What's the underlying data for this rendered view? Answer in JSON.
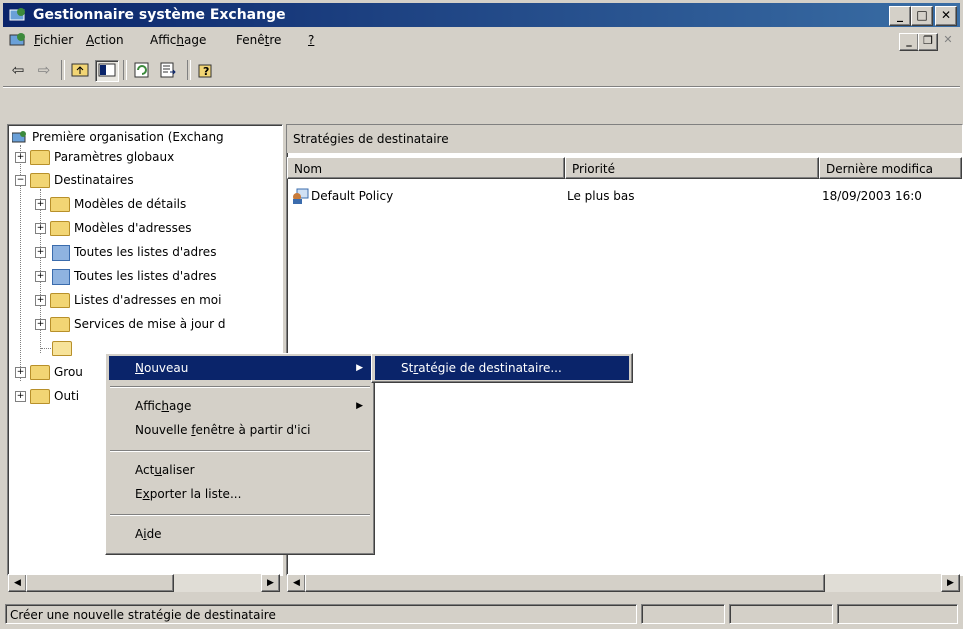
{
  "window": {
    "title": "Gestionnaire système Exchange",
    "caption_buttons": [
      "_",
      "□",
      "✕"
    ]
  },
  "menu": {
    "items": [
      {
        "label": "Fichier",
        "underline": "F",
        "rest": "ichier"
      },
      {
        "label": "Action",
        "underline": "A",
        "rest": "ction"
      },
      {
        "label": "Affichage",
        "pre": "Affic",
        "underline": "h",
        "rest": "age"
      },
      {
        "label": "Fenêtre",
        "pre": "Fenê",
        "underline": "t",
        "rest": "re"
      },
      {
        "label": "?",
        "underline": "?",
        "rest": ""
      }
    ]
  },
  "toolbar": {
    "icons": [
      "back-arrow-icon",
      "forward-arrow-icon",
      "up-folder-icon",
      "show-hide-tree-icon",
      "refresh-icon",
      "export-list-icon",
      "help-icon"
    ]
  },
  "tree": {
    "root": "Première organisation (Exchang",
    "items": [
      {
        "label": "Paramètres globaux",
        "level": 1,
        "icon": "folder",
        "expander": "+"
      },
      {
        "label": "Destinataires",
        "level": 1,
        "icon": "folder",
        "expander": "−"
      },
      {
        "label": "Modèles de détails",
        "level": 2,
        "icon": "folder",
        "expander": "+"
      },
      {
        "label": "Modèles d'adresses",
        "level": 2,
        "icon": "folder",
        "expander": "+"
      },
      {
        "label": "Toutes les listes d'adres",
        "level": 2,
        "icon": "book",
        "expander": "+"
      },
      {
        "label": "Toutes les listes d'adres",
        "level": 2,
        "icon": "book",
        "expander": "+"
      },
      {
        "label": "Listes d'adresses en moi",
        "level": 2,
        "icon": "folder",
        "expander": "+"
      },
      {
        "label": "Services de mise à jour d",
        "level": 2,
        "icon": "folder",
        "expander": "+"
      },
      {
        "label": "",
        "level": 2,
        "icon": "folder-open",
        "expander": ""
      },
      {
        "label": "Grou",
        "level": 1,
        "icon": "folder",
        "expander": "+"
      },
      {
        "label": "Outi",
        "level": 1,
        "icon": "folder",
        "expander": "+"
      }
    ]
  },
  "right": {
    "header": "Stratégies de destinataire",
    "columns": [
      "Nom",
      "Priorité",
      "Dernière modifica"
    ],
    "rows": [
      {
        "name": "Default Policy",
        "priority": "Le plus bas",
        "modified": "18/09/2003 16:0"
      }
    ]
  },
  "context_menu": {
    "items": [
      {
        "pre": "",
        "underline": "N",
        "rest": "ouveau",
        "submenu": true
      },
      {
        "pre": "Affic",
        "underline": "h",
        "rest": "age",
        "submenu": true
      },
      {
        "pre": "Nouvelle ",
        "underline": "f",
        "rest": "enêtre à partir d'ici",
        "submenu": false
      },
      {
        "pre": "Act",
        "underline": "u",
        "rest": "aliser",
        "submenu": false
      },
      {
        "pre": "E",
        "underline": "x",
        "rest": "porter la liste...",
        "submenu": false
      },
      {
        "pre": "A",
        "underline": "i",
        "rest": "de",
        "submenu": false
      }
    ]
  },
  "submenu": {
    "item": {
      "pre": "St",
      "underline": "r",
      "rest": "atégie de destinataire..."
    }
  },
  "status": {
    "text": "Créer une nouvelle stratégie de destinataire"
  },
  "colors": {
    "title_start": "#0a246a",
    "title_end": "#3a6ea5",
    "highlight": "#0a246a",
    "chrome": "#d4d0c8"
  }
}
